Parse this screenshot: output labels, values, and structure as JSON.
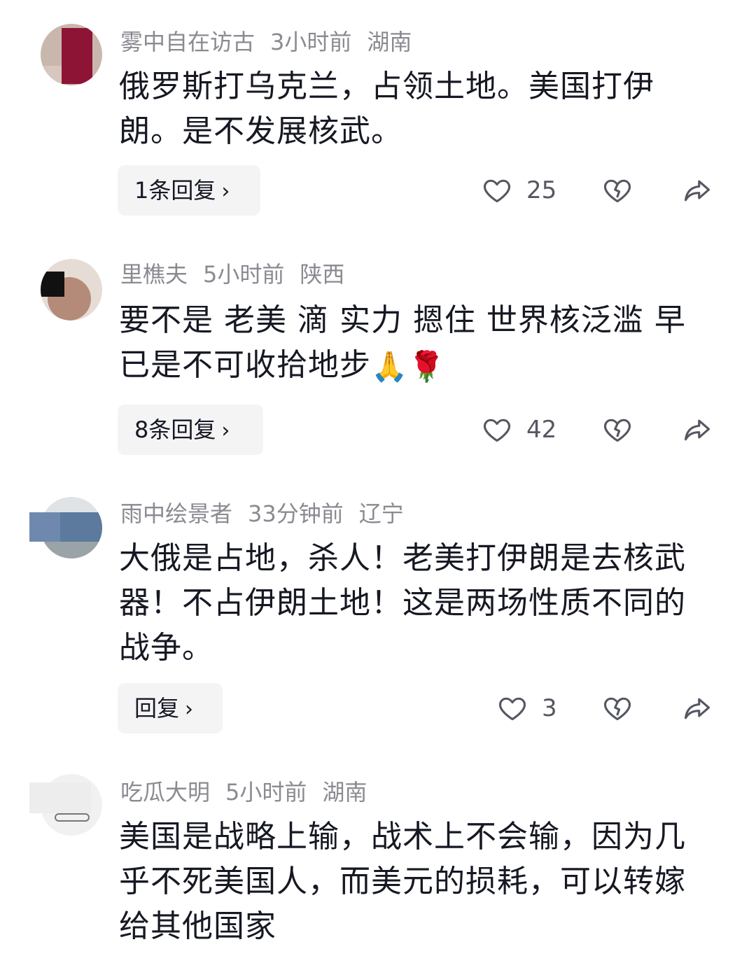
{
  "comments": [
    {
      "username": "雾中自在访古",
      "time": "3小时前",
      "location": "湖南",
      "text": "俄罗斯打乌克兰，占领土地。美国打伊朗。是不发展核武。",
      "reply_label": "1条回复",
      "likes": "25"
    },
    {
      "username": "里樵夫",
      "time": "5小时前",
      "location": "陕西",
      "text": "要不是 老美 滴 实力 摁住 世界核泛滥 早已是不可收拾地步",
      "emojis": "🙏🌹",
      "reply_label": "8条回复",
      "likes": "42"
    },
    {
      "username": "雨中绘景者",
      "time": "33分钟前",
      "location": "辽宁",
      "text": "大俄是占地，杀人！老美打伊朗是去核武器！不占伊朗土地！这是两场性质不同的战争。",
      "reply_label": "回复",
      "likes": "3"
    },
    {
      "username": "吃瓜大明",
      "time": "5小时前",
      "location": "湖南",
      "text": "美国是战略上输，战术上不会输，因为几乎不死美国人，而美元的损耗，可以转嫁给其他国家"
    }
  ],
  "icons": {
    "like": "heart-outline-icon",
    "dislike": "broken-heart-icon",
    "share": "share-arrow-icon",
    "chevron": "chevron-right-icon"
  },
  "colors": {
    "meta_text": "#8a8b91",
    "body_text": "#161823",
    "reply_bg": "#f4f4f5",
    "icon": "#555761"
  }
}
